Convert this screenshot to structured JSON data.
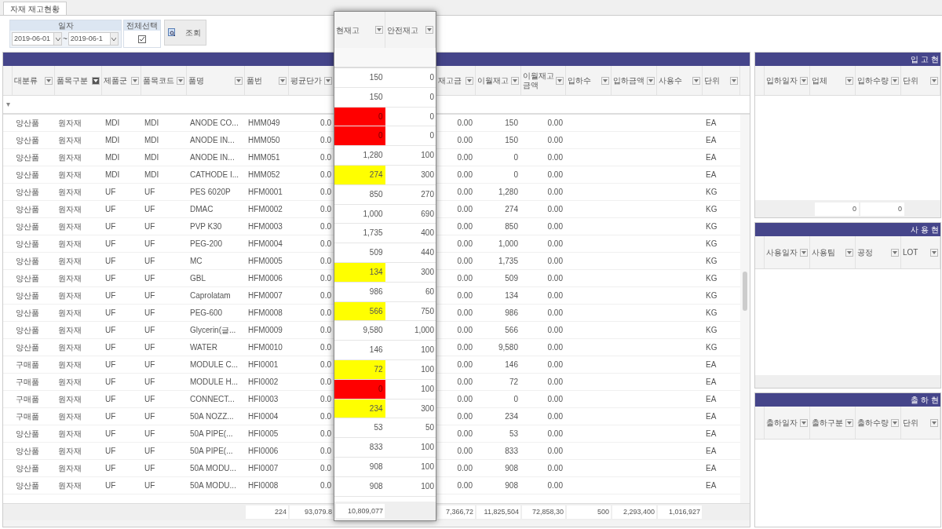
{
  "tabs": [
    {
      "label": "자재 재고현황",
      "selected": true
    }
  ],
  "filters": {
    "date_label": "일자",
    "date_from": "2019-06-01",
    "separator": "~",
    "date_to": "2019-06-1",
    "select_all_label": "전체선택",
    "select_all_checked": true,
    "search_button": "조회"
  },
  "main_grid": {
    "columns": [
      {
        "label": "대분류",
        "filtered": false
      },
      {
        "label": "품목구분",
        "filtered": true
      },
      {
        "label": "제품군",
        "filtered": false
      },
      {
        "label": "품목코드",
        "filtered": false
      },
      {
        "label": "품명",
        "filtered": false
      },
      {
        "label": "품번",
        "filtered": false
      },
      {
        "label": "평균단가",
        "filtered": false
      },
      {
        "label": "재고금",
        "filtered": false
      },
      {
        "label": "이월재고",
        "filtered": false
      },
      {
        "label": "이월재고 금액",
        "filtered": false
      },
      {
        "label": "입하수",
        "filtered": false
      },
      {
        "label": "입하금액",
        "filtered": false
      },
      {
        "label": "사용수",
        "filtered": false
      },
      {
        "label": "단위",
        "filtered": false
      }
    ],
    "rows": [
      {
        "cells": [
          "양산품",
          "원자재",
          "MDI",
          "MDI",
          "ANODE CO...",
          "HMM049",
          "0.0",
          "0.00",
          "150",
          "0.00",
          "EA"
        ]
      },
      {
        "cells": [
          "양산품",
          "원자재",
          "MDI",
          "MDI",
          "ANODE IN...",
          "HMM050",
          "0.0",
          "0.00",
          "150",
          "0.00",
          "EA"
        ]
      },
      {
        "cells": [
          "양산품",
          "원자재",
          "MDI",
          "MDI",
          "ANODE IN...",
          "HMM051",
          "0.0",
          "0.00",
          "0",
          "0.00",
          "EA"
        ]
      },
      {
        "cells": [
          "양산품",
          "원자재",
          "MDI",
          "MDI",
          "CATHODE I...",
          "HMM052",
          "0.0",
          "0.00",
          "0",
          "0.00",
          "EA"
        ]
      },
      {
        "cells": [
          "양산품",
          "원자재",
          "UF",
          "UF",
          "PES 6020P",
          "HFM0001",
          "0.0",
          "0.00",
          "1,280",
          "0.00",
          "KG"
        ]
      },
      {
        "cells": [
          "양산품",
          "원자재",
          "UF",
          "UF",
          "DMAC",
          "HFM0002",
          "0.0",
          "0.00",
          "274",
          "0.00",
          "KG"
        ]
      },
      {
        "cells": [
          "양산품",
          "원자재",
          "UF",
          "UF",
          "PVP K30",
          "HFM0003",
          "0.0",
          "0.00",
          "850",
          "0.00",
          "KG"
        ]
      },
      {
        "cells": [
          "양산품",
          "원자재",
          "UF",
          "UF",
          "PEG-200",
          "HFM0004",
          "0.0",
          "0.00",
          "1,000",
          "0.00",
          "KG"
        ]
      },
      {
        "cells": [
          "양산품",
          "원자재",
          "UF",
          "UF",
          "MC",
          "HFM0005",
          "0.0",
          "0.00",
          "1,735",
          "0.00",
          "KG"
        ]
      },
      {
        "cells": [
          "양산품",
          "원자재",
          "UF",
          "UF",
          "GBL",
          "HFM0006",
          "0.0",
          "0.00",
          "509",
          "0.00",
          "KG"
        ]
      },
      {
        "cells": [
          "양산품",
          "원자재",
          "UF",
          "UF",
          "Caprolatam",
          "HFM0007",
          "0.0",
          "0.00",
          "134",
          "0.00",
          "KG"
        ]
      },
      {
        "cells": [
          "양산품",
          "원자재",
          "UF",
          "UF",
          "PEG-600",
          "HFM0008",
          "0.0",
          "0.00",
          "986",
          "0.00",
          "KG"
        ]
      },
      {
        "cells": [
          "양산품",
          "원자재",
          "UF",
          "UF",
          "Glycerin(글...",
          "HFM0009",
          "0.0",
          "0.00",
          "566",
          "0.00",
          "KG"
        ]
      },
      {
        "cells": [
          "양산품",
          "원자재",
          "UF",
          "UF",
          "WATER",
          "HFM0010",
          "0.0",
          "0.00",
          "9,580",
          "0.00",
          "KG"
        ]
      },
      {
        "cells": [
          "구매품",
          "원자재",
          "UF",
          "UF",
          "MODULE C...",
          "HFI0001",
          "0.0",
          "0.00",
          "146",
          "0.00",
          "EA"
        ]
      },
      {
        "cells": [
          "구매품",
          "원자재",
          "UF",
          "UF",
          "MODULE H...",
          "HFI0002",
          "0.0",
          "0.00",
          "72",
          "0.00",
          "EA"
        ]
      },
      {
        "cells": [
          "구매품",
          "원자재",
          "UF",
          "UF",
          "CONNECT...",
          "HFI0003",
          "0.0",
          "0.00",
          "0",
          "0.00",
          "EA"
        ]
      },
      {
        "cells": [
          "구매품",
          "원자재",
          "UF",
          "UF",
          "50A NOZZ...",
          "HFI0004",
          "0.0",
          "0.00",
          "234",
          "0.00",
          "EA"
        ]
      },
      {
        "cells": [
          "양산품",
          "원자재",
          "UF",
          "UF",
          "50A PIPE(...",
          "HFI0005",
          "0.0",
          "0.00",
          "53",
          "0.00",
          "EA"
        ]
      },
      {
        "cells": [
          "양산품",
          "원자재",
          "UF",
          "UF",
          "50A PIPE(...",
          "HFI0006",
          "0.0",
          "0.00",
          "833",
          "0.00",
          "EA"
        ]
      },
      {
        "cells": [
          "양산품",
          "원자재",
          "UF",
          "UF",
          "50A MODU...",
          "HFI0007",
          "0.0",
          "0.00",
          "908",
          "0.00",
          "EA"
        ]
      },
      {
        "cells": [
          "양산품",
          "원자재",
          "UF",
          "UF",
          "50A MODU...",
          "HFI0008",
          "0.0",
          "0.00",
          "908",
          "0.00",
          "EA"
        ]
      }
    ],
    "totals": [
      "224",
      "93,079.8",
      "7,366,72",
      "11,825,504",
      "72,858,30",
      "500",
      "2,293,400",
      "1,016,927"
    ]
  },
  "popup": {
    "columns": [
      {
        "label": "현재고"
      },
      {
        "label": "안전재고"
      }
    ],
    "rows": [
      {
        "current": "150",
        "safety": "0",
        "kind": "ok"
      },
      {
        "current": "150",
        "safety": "0",
        "kind": "ok"
      },
      {
        "current": "0",
        "safety": "0",
        "kind": "empty"
      },
      {
        "current": "0",
        "safety": "0",
        "kind": "empty"
      },
      {
        "current": "1,280",
        "safety": "100",
        "kind": "ok"
      },
      {
        "current": "274",
        "safety": "300",
        "kind": "low"
      },
      {
        "current": "850",
        "safety": "270",
        "kind": "ok"
      },
      {
        "current": "1,000",
        "safety": "690",
        "kind": "ok"
      },
      {
        "current": "1,735",
        "safety": "400",
        "kind": "ok"
      },
      {
        "current": "509",
        "safety": "440",
        "kind": "ok"
      },
      {
        "current": "134",
        "safety": "300",
        "kind": "low"
      },
      {
        "current": "986",
        "safety": "60",
        "kind": "ok"
      },
      {
        "current": "566",
        "safety": "750",
        "kind": "low"
      },
      {
        "current": "9,580",
        "safety": "1,000",
        "kind": "ok"
      },
      {
        "current": "146",
        "safety": "100",
        "kind": "ok"
      },
      {
        "current": "72",
        "safety": "100",
        "kind": "low"
      },
      {
        "current": "0",
        "safety": "100",
        "kind": "empty"
      },
      {
        "current": "234",
        "safety": "300",
        "kind": "low"
      },
      {
        "current": "53",
        "safety": "50",
        "kind": "ok"
      },
      {
        "current": "833",
        "safety": "100",
        "kind": "ok"
      },
      {
        "current": "908",
        "safety": "100",
        "kind": "ok"
      },
      {
        "current": "908",
        "safety": "100",
        "kind": "ok"
      }
    ],
    "total": "10,809,077"
  },
  "side_panels": [
    {
      "title": "입 고 현",
      "columns": [
        "입하일자",
        "업체",
        "입하수량",
        "단위"
      ],
      "totals": [
        "0",
        "0"
      ]
    },
    {
      "title": "사 용 현",
      "columns": [
        "사용일자",
        "사용팀",
        "공정",
        "LOT"
      ]
    },
    {
      "title": "출 하 현",
      "columns": [
        "출하일자",
        "출하구분",
        "출하수량",
        "단위"
      ]
    }
  ]
}
